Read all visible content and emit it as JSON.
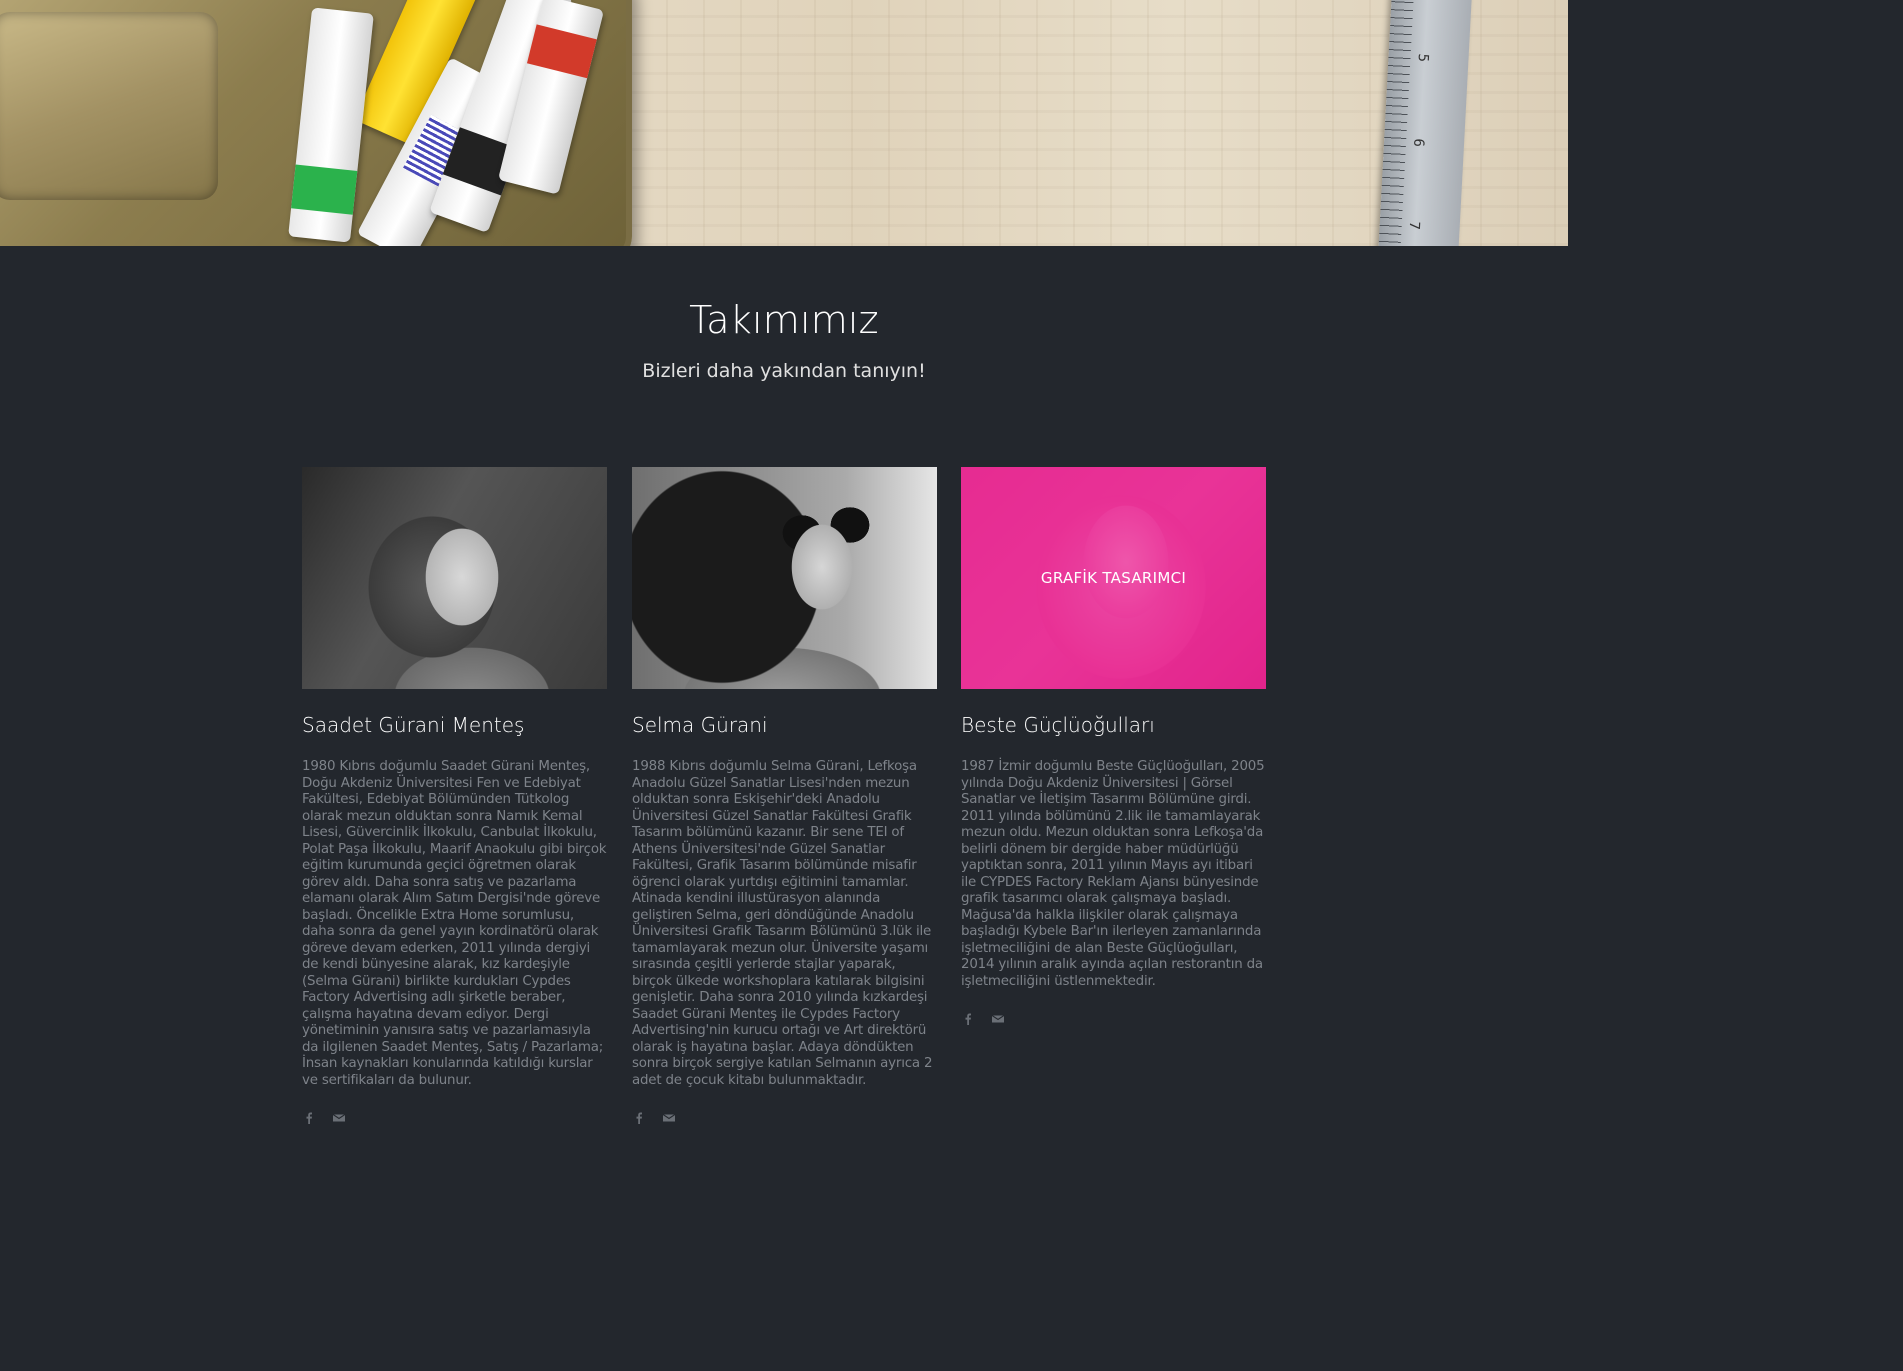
{
  "section": {
    "title": "Takımımız",
    "subtitle": "Bizleri daha yakından tanıyın!"
  },
  "hero": {
    "ruler_numbers": [
      "5",
      "6",
      "7"
    ]
  },
  "members": [
    {
      "name": "Saadet Gürani Menteş",
      "bio": "1980 Kıbrıs doğumlu Saadet Gürani Menteş, Doğu Akdeniz Üniversitesi Fen ve Edebiyat Fakültesi, Edebiyat Bölümünden Tütkolog olarak mezun olduktan sonra Namık Kemal Lisesi, Güvercinlik İlkokulu, Canbulat İlkokulu, Polat Paşa İlkokulu, Maarif Anaokulu gibi birçok eğitim kurumunda geçici öğretmen olarak görev aldı. Daha sonra satış ve pazarlama elamanı olarak Alım Satım Dergisi'nde göreve başladı. Öncelikle Extra Home sorumlusu, daha sonra da genel yayın kordinatörü olarak göreve devam ederken, 2011 yılında dergiyi de kendi bünyesine alarak, kız kardeşiyle (Selma Gürani) birlikte kurdukları Cypdes Factory Advertising adlı şirketle beraber, çalışma hayatına devam ediyor. Dergi yönetiminin yanısıra satış ve pazarlamasıyla da ilgilenen Saadet Menteş, Satış / Pazarlama; İnsan kaynakları konularında katıldığı kurslar ve sertifikaları da bulunur."
    },
    {
      "name": "Selma Gürani",
      "bio": "1988 Kıbrıs doğumlu Selma Gürani, Lefkoşa Anadolu Güzel Sanatlar Lisesi'nden mezun olduktan sonra Eskişehir'deki Anadolu Üniversitesi Güzel Sanatlar Fakültesi Grafik Tasarım bölümünü kazanır. Bir sene TEI of Athens Üniversitesi'nde Güzel Sanatlar Fakültesi, Grafik Tasarım bölümünde misafir öğrenci olarak yurtdışı eğitimini tamamlar. Atinada kendini illustürasyon alanında geliştiren Selma, geri döndüğünde Anadolu Üniversitesi Grafik Tasarım Bölümünü 3.lük ile tamamlayarak mezun olur. Üniversite yaşamı sırasında çeşitli yerlerde stajlar yaparak, birçok ülkede workshoplara katılarak bilgisini genişletir. Daha sonra 2010 yılında kızkardeşi Saadet Gürani Menteş ile Cypdes Factory Advertising'nin kurucu ortağı ve Art direktörü olarak iş hayatına başlar. Adaya döndükten sonra birçok sergiye katılan Selmanın ayrıca 2 adet de çocuk kitabı bulunmaktadır."
    },
    {
      "name": "Beste Güçlüoğulları",
      "role": "GRAFİK TASARIMCI",
      "bio": "1987 İzmir doğumlu Beste Güçlüoğulları, 2005 yılında Doğu Akdeniz Üniversitesi | Görsel Sanatlar ve İletişim Tasarımı Bölümüne girdi. 2011 yılında bölümünü 2.lik ile tamamlayarak mezun oldu. Mezun olduktan sonra Lefkoşa'da belirli dönem bir dergide haber müdürlüğü yaptıktan sonra, 2011 yılının Mayıs ayı itibari ile CYPDES Factory Reklam Ajansı bünyesinde grafik tasarımcı olarak çalışmaya başladı. Mağusa'da halkla ilişkiler olarak çalışmaya başladığı Kybele Bar'ın ilerleyen zamanlarında işletmeciliğini de alan Beste Güçlüoğulları, 2014 yılının aralık ayında açılan restorantın da işletmeciliğini üstlenmektedir."
    }
  ],
  "icons": {
    "facebook": "facebook-icon",
    "email": "email-icon"
  },
  "colors": {
    "background": "#23272d",
    "accent_pink": "#e71e8c",
    "bio_text": "#7e838a"
  }
}
